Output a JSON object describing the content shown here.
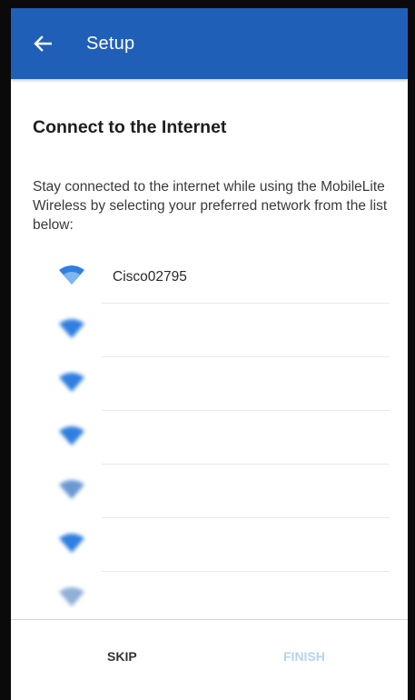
{
  "app_bar": {
    "title": "Setup",
    "back_icon": "arrow-left-icon",
    "color": "#1f5fb8"
  },
  "page": {
    "heading": "Connect to the Internet",
    "description": "Stay connected to the internet while using the MobileLite Wireless by selecting your preferred network from the list below:"
  },
  "networks": [
    {
      "ssid": "Cisco02795",
      "icon": "wifi-icon",
      "state": "clear"
    },
    {
      "ssid": "",
      "icon": "wifi-icon",
      "state": "blurred"
    },
    {
      "ssid": "",
      "icon": "wifi-icon",
      "state": "blurred"
    },
    {
      "ssid": "",
      "icon": "wifi-icon",
      "state": "blurred"
    },
    {
      "ssid": "",
      "icon": "wifi-icon",
      "state": "blurred"
    },
    {
      "ssid": "",
      "icon": "wifi-icon",
      "state": "blurred"
    },
    {
      "ssid": "",
      "icon": "wifi-icon",
      "state": "blurred"
    }
  ],
  "footer": {
    "skip_label": "SKIP",
    "finish_label": "FINISH",
    "finish_color": "#b7d3ef"
  },
  "colors": {
    "wifi_icon": "#2f7fe0"
  }
}
